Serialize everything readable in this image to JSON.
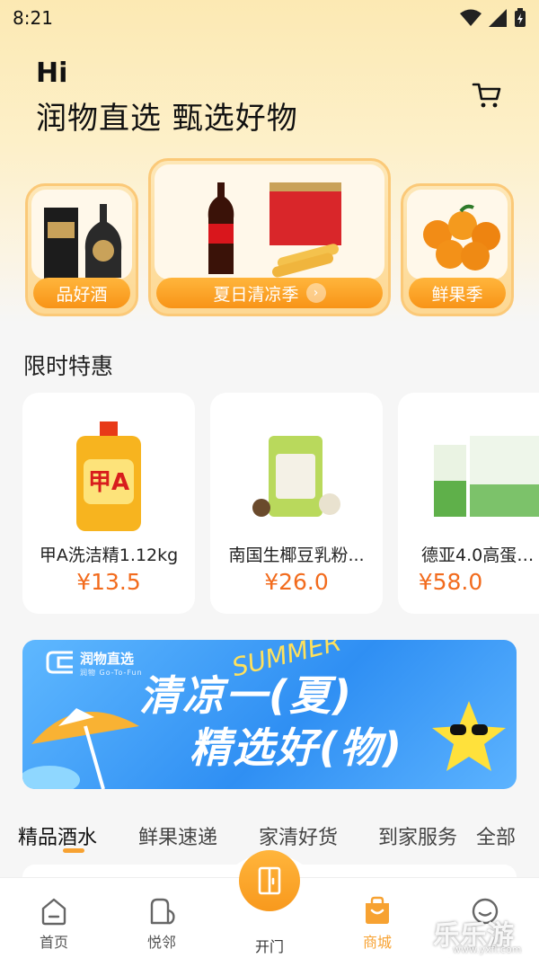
{
  "status_bar": {
    "time": "8:21"
  },
  "header": {
    "greeting": "Hi",
    "slogan": "润物直选 甄选好物"
  },
  "categories": [
    {
      "label": "品好酒"
    },
    {
      "label": "夏日清凉季"
    },
    {
      "label": "鲜果季"
    }
  ],
  "deals": {
    "title": "限时特惠",
    "items": [
      {
        "name": "甲A洗洁精1.12kg",
        "price": "¥13.5"
      },
      {
        "name": "南国生椰豆乳粉...",
        "price": "¥26.0"
      },
      {
        "name": "德亚4.0高蛋白...",
        "price": "¥58.0"
      }
    ]
  },
  "banner": {
    "brand": "润物直选",
    "brand_sub": "润物 Go-To-Fun",
    "summer": "SUMMER",
    "line1": "清凉一(夏)",
    "line2": "精选好(物)"
  },
  "tabs": [
    "精品酒水",
    "鲜果速递",
    "家清好货",
    "到家服务",
    "全部"
  ],
  "bottom_nav": {
    "home": "首页",
    "neighbors": "悦邻",
    "open_door": "开门",
    "mall": "商城",
    "me": ""
  },
  "watermark": {
    "text": "乐乐游戏",
    "url": "www.yxfl.com"
  },
  "colors": {
    "accent": "#f7a232",
    "price": "#f26b1d",
    "banner": "#2f8ff3"
  }
}
